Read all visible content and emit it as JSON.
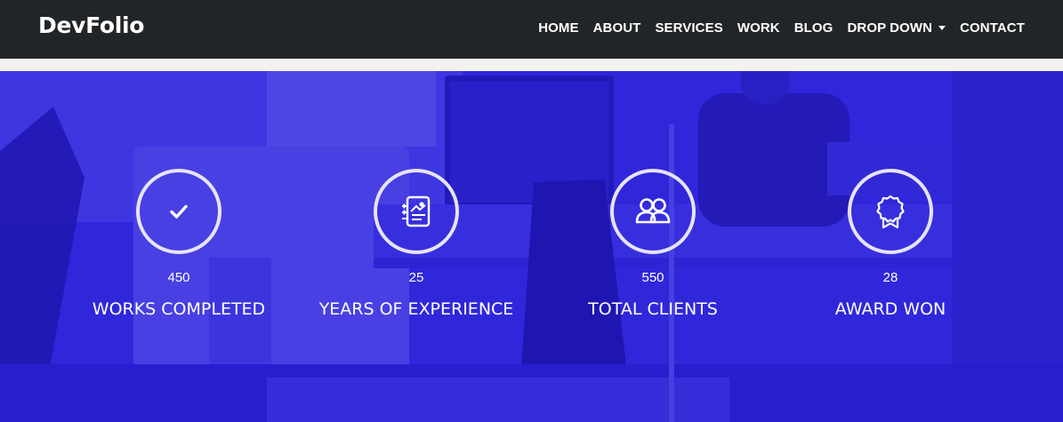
{
  "header": {
    "brand": "DevFolio",
    "nav": [
      {
        "label": "HOME"
      },
      {
        "label": "ABOUT"
      },
      {
        "label": "SERVICES"
      },
      {
        "label": "WORK"
      },
      {
        "label": "BLOG"
      },
      {
        "label": "DROP DOWN"
      },
      {
        "label": "CONTACT"
      }
    ]
  },
  "counters": [
    {
      "value": "450",
      "label": "WORKS COMPLETED",
      "icon": "checkmark-icon"
    },
    {
      "value": "25",
      "label": "YEARS OF EXPERIENCE",
      "icon": "report-icon"
    },
    {
      "value": "550",
      "label": "TOTAL CLIENTS",
      "icon": "people-icon"
    },
    {
      "value": "28",
      "label": "AWARD WON",
      "icon": "award-ribbon-icon"
    }
  ],
  "colors": {
    "navbar_bg": "#222527",
    "overlay": "#2a21c9",
    "text": "#ffffff"
  }
}
